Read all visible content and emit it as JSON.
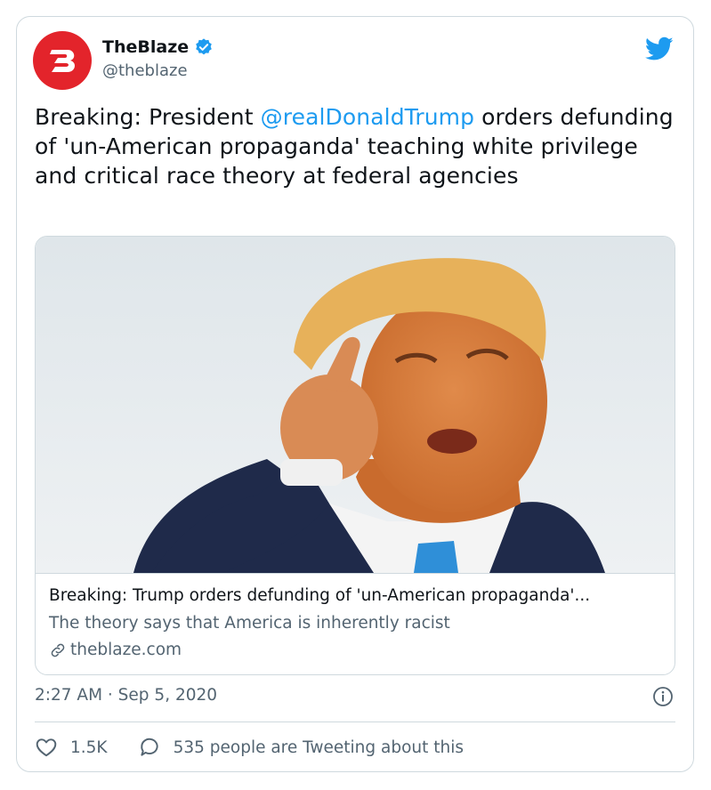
{
  "author": {
    "display_name": "TheBlaze",
    "handle": "@theblaze",
    "avatar_letter": "B",
    "brand_color": "#e3242b",
    "verified": true
  },
  "tweet": {
    "text_before": "Breaking: President ",
    "mention": "@realDonaldTrump",
    "text_after": " orders defunding of 'un-American propaganda' teaching white privilege and critical race theory at federal agencies"
  },
  "card": {
    "title": "Breaking: Trump orders defunding of 'un-American propaganda'...",
    "description": "The theory says that America is inherently racist",
    "domain": "theblaze.com"
  },
  "timestamp": "2:27 AM · Sep 5, 2020",
  "actions": {
    "likes": "1.5K",
    "conversation": "535 people are Tweeting about this"
  },
  "colors": {
    "accent": "#1d9bf0",
    "secondary_text": "#536471",
    "like_icon": "#536471"
  }
}
